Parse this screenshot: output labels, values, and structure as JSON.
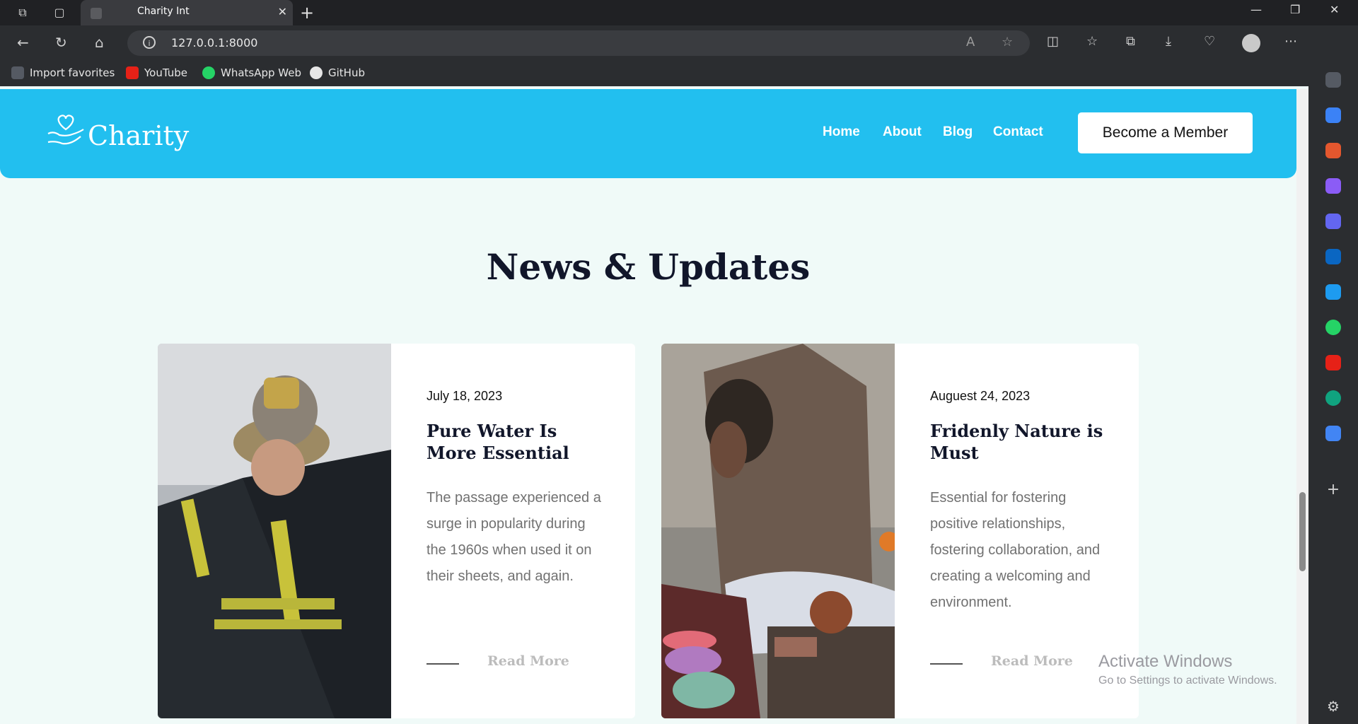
{
  "browser": {
    "tab_title": "Charity Int",
    "tab_close": "✕",
    "new_tab": "+",
    "url": "127.0.0.1:8000",
    "window_controls": {
      "minimize": "—",
      "restore": "❐",
      "close": "✕"
    },
    "bookmarks": [
      {
        "label": "Import favorites",
        "icon": "import-icon",
        "color": "#555a63"
      },
      {
        "label": "YouTube",
        "icon": "youtube-icon",
        "color": "#e62117"
      },
      {
        "label": "WhatsApp Web",
        "icon": "whatsapp-icon",
        "color": "#25d366"
      },
      {
        "label": "GitHub",
        "icon": "github-icon",
        "color": "#e6e6e6"
      }
    ]
  },
  "site": {
    "logo_text": "Charity",
    "nav": [
      "Home",
      "About",
      "Blog",
      "Contact"
    ],
    "cta": "Become a Member",
    "header_color": "#22bfef"
  },
  "news": {
    "title": "News & Updates",
    "cards": [
      {
        "date": "July 18, 2023",
        "title": "Pure Water Is More Essential",
        "text": "The passage experienced a surge in popularity during the 1960s when used it on their sheets, and again.",
        "link": "Read More"
      },
      {
        "date": "Auguest 24, 2023",
        "title": "Fridenly Nature is Must",
        "text": "Essential for fostering positive relationships, fostering collaboration, and creating a welcoming and environment.",
        "link": "Read More"
      }
    ]
  },
  "watermark": {
    "line1": "Activate Windows",
    "line2": "Go to Settings to activate Windows."
  }
}
